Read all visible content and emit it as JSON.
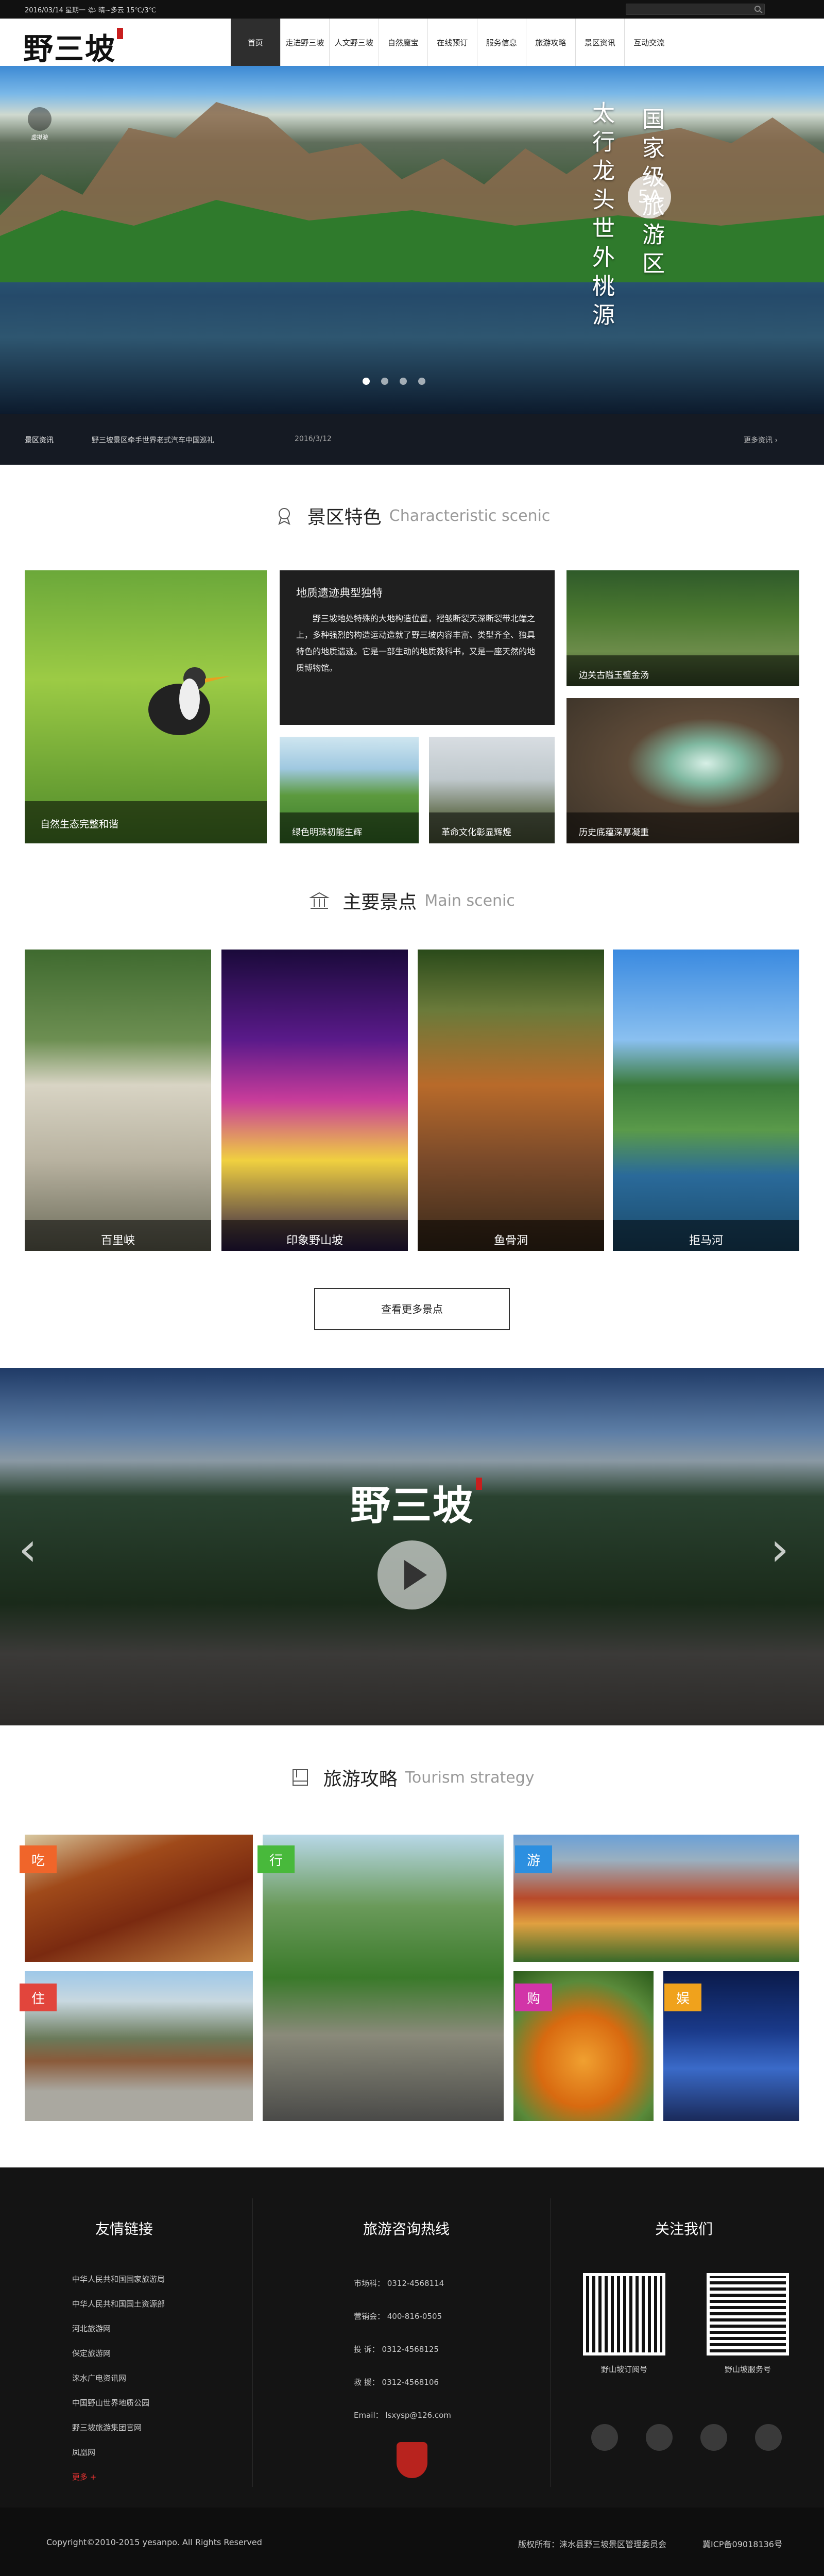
{
  "topbar": {
    "date": "2016/03/14  星期一   🌤 晴~多云  15℃/3℃"
  },
  "logo": {
    "text": "野三坡"
  },
  "nav": [
    "首页",
    "走进野三坡",
    "人文野三坡",
    "自然魔宝",
    "在线预订",
    "服务信息",
    "旅游攻略",
    "景区资讯",
    "互动交流"
  ],
  "hero": {
    "vertical_line1": "太行龙头世外桃源",
    "vertical_line2": "国家级旅游区",
    "badge": "5A",
    "vr_label": "虚拟游"
  },
  "news": {
    "tag": "景区资讯",
    "headline": "野三坡景区牵手世界老式汽车中国巡礼",
    "date": "2016/3/12",
    "more": "更多资讯 ›"
  },
  "section_scenic": {
    "cn": "景区特色",
    "en": "Characteristic scenic"
  },
  "scenic_tiles": {
    "nature": "自然生态完整和谐",
    "geo_title": "地质遗迹典型独特",
    "geo_desc": "野三坡地处特殊的大地构造位置，褶皱断裂天深断裂带北端之上，多种强烈的构造运动造就了野三坡内容丰富、类型齐全、独具特色的地质遗迹。它是一部生动的地质教科书，又是一座天然的地质博物馆。",
    "green": "绿色明珠初能生辉",
    "revolution": "革命文化彰显辉煌",
    "gate": "边关古隘玉璧金汤",
    "history": "历史底蕴深厚凝重"
  },
  "section_main": {
    "cn": "主要景点",
    "en": "Main scenic"
  },
  "spots": [
    "百里峡",
    "印象野山坡",
    "鱼骨洞",
    "拒马河"
  ],
  "more_spots": "查看更多景点",
  "video": {
    "logo": "野三坡"
  },
  "section_strategy": {
    "cn": "旅游攻略",
    "en": "Tourism strategy"
  },
  "strategy_badges": {
    "eat": "吃",
    "go": "行",
    "tour": "游",
    "stay": "住",
    "shop": "购",
    "fun": "娱"
  },
  "badge_colors": {
    "eat": "#f0652a",
    "go": "#48b93b",
    "tour": "#2c8fe0",
    "stay": "#e2453c",
    "shop": "#d234a8",
    "fun": "#f0a21c"
  },
  "footer": {
    "links_title": "友情链接",
    "links": [
      "中华人民共和国国家旅游局",
      "中华人民共和国国土资源部",
      "河北旅游网",
      "保定旅游网",
      "涞水广电资讯网",
      "中国野山世界地质公园",
      "野三坡旅游集团官网",
      "凤凰网"
    ],
    "more": "更多 +",
    "hotline_title": "旅游咨询热线",
    "hotline": [
      "市场科：  0312-4568114",
      "营销会：  400-816-0505",
      "投    诉：  0312-4568125",
      "救    援：  0312-4568106",
      "Email：  lsxysp@126.com"
    ],
    "follow_title": "关注我们",
    "qr1": "野山坡订阅号",
    "qr2": "野山坡服务号"
  },
  "bottom": {
    "copyright": "Copyright©2010-2015 yesanpo. All Rights Reserved",
    "owner": "版权所有：涞水县野三坡景区管理委员会",
    "icp": "冀ICP备09018136号"
  }
}
